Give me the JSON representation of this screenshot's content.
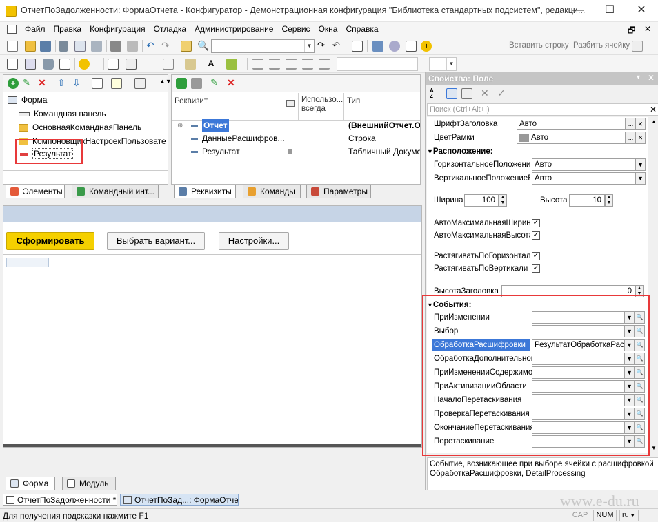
{
  "window": {
    "title": "ОтчетПоЗадолженности: ФормаОтчета - Конфигуратор - Демонстрационная конфигурация \"Библиотека стандартных подсистем\", редакци...",
    "minimize": "—",
    "maximize": "☐",
    "close": "✕"
  },
  "menu": {
    "items": [
      "Файл",
      "Правка",
      "Конфигурация",
      "Отладка",
      "Администрирование",
      "Сервис",
      "Окна",
      "Справка"
    ],
    "restore": "🗗",
    "close": "✕"
  },
  "toolbar": {
    "insert_row": "Вставить строку",
    "split_cell": "Разбить ячейку"
  },
  "elements_panel": {
    "tree": [
      {
        "label": "Форма"
      },
      {
        "label": "Командная панель"
      },
      {
        "label": "ОсновнаяКоманднаяПанель"
      },
      {
        "label": "КомпоновщикНастроекПользователь"
      },
      {
        "label": "Результат"
      }
    ],
    "tabs": [
      "Элементы",
      "Командный инт..."
    ]
  },
  "requisites_panel": {
    "columns": [
      "Реквизит",
      "Использо... всегда",
      "Тип"
    ],
    "rows": [
      {
        "name": "Отчет",
        "type": "(ВнешнийОтчет.От"
      },
      {
        "name": "ДанныеРасшифров...",
        "type": "Строка"
      },
      {
        "name": "Результат",
        "type": "Табличный Документ"
      }
    ],
    "tabs": [
      "Реквизиты",
      "Команды",
      "Параметры"
    ]
  },
  "form_preview": {
    "generate_button": "Сформировать",
    "choose_variant_button": "Выбрать вариант...",
    "settings_button": "Настройки..."
  },
  "bottom_tabs": [
    "Форма",
    "Модуль"
  ],
  "properties": {
    "title": "Свойства: Поле",
    "search_placeholder": "Поиск (Ctrl+Alt+I)",
    "font_header_label": "ШрифтЗаголовка",
    "font_header_value": "Авто",
    "border_color_label": "ЦветРамки",
    "border_color_value": "Авто",
    "location_group": "Расположение:",
    "horiz_pos_label": "ГоризонтальноеПоложение",
    "horiz_pos_value": "Авто",
    "vert_pos_label": "ВертикальноеПоложениеВГ",
    "vert_pos_value": "Авто",
    "width_label": "Ширина",
    "width_value": "100",
    "height_label": "Высота",
    "height_value": "10",
    "auto_max_width_label": "АвтоМаксимальнаяШирина",
    "auto_max_height_label": "АвтоМаксимальнаяВысота",
    "stretch_h_label": "РастягиватьПоГоризонтали",
    "stretch_v_label": "РастягиватьПоВертикали",
    "header_height_label": "ВысотаЗаголовка",
    "header_height_value": "0",
    "events_group": "События:",
    "events": [
      {
        "label": "ПриИзменении",
        "value": ""
      },
      {
        "label": "Выбор",
        "value": ""
      },
      {
        "label": "ОбработкаРасшифровки",
        "value": "РезультатОбработкаРасш"
      },
      {
        "label": "ОбработкаДополнительной",
        "value": ""
      },
      {
        "label": "ПриИзмененииСодержимог",
        "value": ""
      },
      {
        "label": "ПриАктивизацииОбласти",
        "value": ""
      },
      {
        "label": "НачалоПеретаскивания",
        "value": ""
      },
      {
        "label": "ПроверкаПеретаскивания",
        "value": ""
      },
      {
        "label": "ОкончаниеПеретаскивания",
        "value": ""
      },
      {
        "label": "Перетаскивание",
        "value": ""
      }
    ],
    "description": "Событие, возникающее при выборе ячейки с расшифровкой ОбработкаРасшифровки, DetailProcessing"
  },
  "taskbar": {
    "items": [
      "ОтчетПоЗадолженности *",
      "ОтчетПоЗад...: ФормаОтчета"
    ]
  },
  "watermark": "www.e-du.ru",
  "status": {
    "hint": "Для получения подсказки нажмите F1",
    "cap": "CAP",
    "num": "NUM",
    "lang": "ru"
  },
  "colors": {
    "highlight_red": "#e8393a",
    "selection_blue": "#3c78d8",
    "generate_yellow": "#f5d000"
  }
}
